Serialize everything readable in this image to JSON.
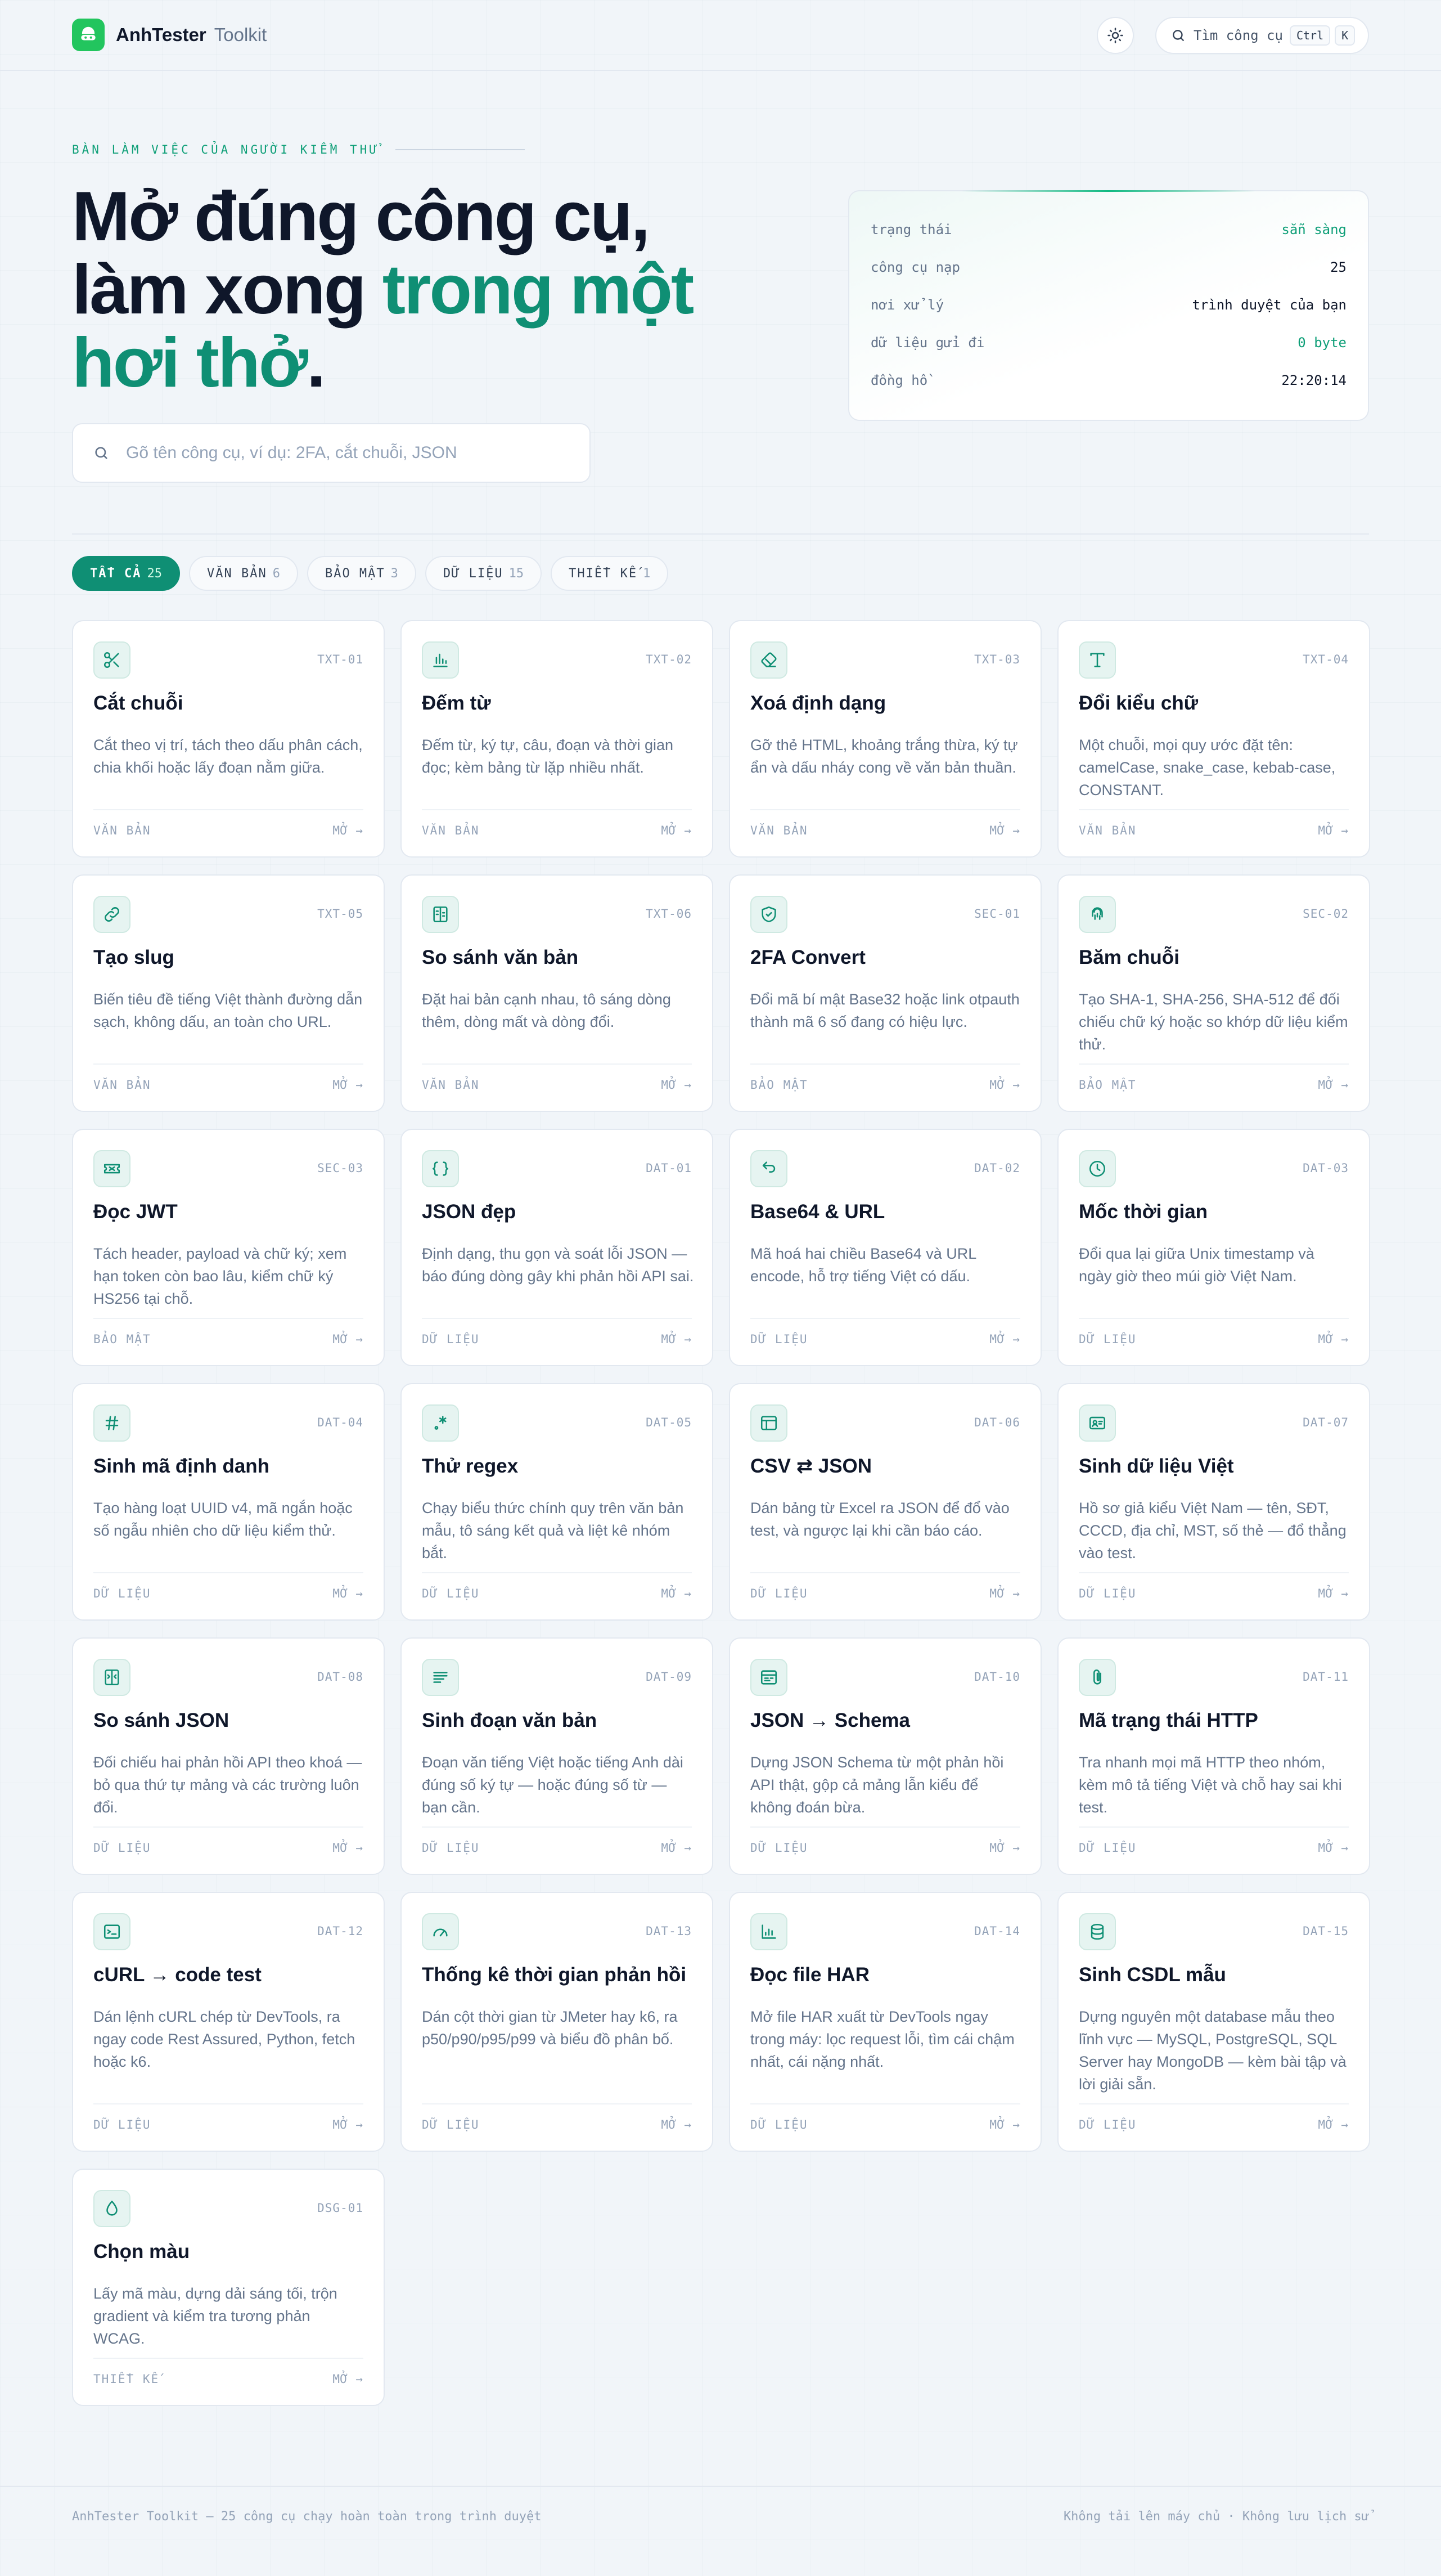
{
  "header": {
    "brand": "AnhTester",
    "brand_sub": "Toolkit",
    "search_label": "Tìm công cụ",
    "shortcut_ctrl": "Ctrl",
    "shortcut_key": "K"
  },
  "hero": {
    "eyebrow": "BÀN LÀM VIỆC CỦA NGƯỜI KIỂM THỬ",
    "title_line1": "Mở đúng công cụ,",
    "title_line2_plain": "làm xong ",
    "title_line2_accent": "trong một",
    "title_line3_accent": "hơi thở",
    "title_line3_end": ".",
    "search_placeholder": "Gõ tên công cụ, ví dụ: 2FA, cắt chuỗi, JSON"
  },
  "status": [
    {
      "key": "trạng thái",
      "value": "sẵn sàng",
      "accent": true
    },
    {
      "key": "công cụ nạp",
      "value": "25",
      "accent": false
    },
    {
      "key": "nơi xử lý",
      "value": "trình duyệt của bạn",
      "accent": false
    },
    {
      "key": "dữ liệu gửi đi",
      "value": "0 byte",
      "accent": true
    },
    {
      "key": "đồng hồ",
      "value": "22:20:14",
      "accent": false
    }
  ],
  "filters": [
    {
      "label": "TẤT CẢ",
      "count": "25",
      "active": true
    },
    {
      "label": "VĂN BẢN",
      "count": "6",
      "active": false
    },
    {
      "label": "BẢO MẬT",
      "count": "3",
      "active": false
    },
    {
      "label": "DỮ LIỆU",
      "count": "15",
      "active": false
    },
    {
      "label": "THIẾT KẾ",
      "count": "1",
      "active": false
    }
  ],
  "open_label": "MỞ →",
  "tools": [
    {
      "code": "TXT-01",
      "icon": "scissors-icon",
      "title": "Cắt chuỗi",
      "desc": "Cắt theo vị trí, tách theo dấu phân cách, chia khối hoặc lấy đoạn nằm giữa.",
      "category": "VĂN BẢN"
    },
    {
      "code": "TXT-02",
      "icon": "bar-count-icon",
      "title": "Đếm từ",
      "desc": "Đếm từ, ký tự, câu, đoạn và thời gian đọc; kèm bảng từ lặp nhiều nhất.",
      "category": "VĂN BẢN"
    },
    {
      "code": "TXT-03",
      "icon": "eraser-icon",
      "title": "Xoá định dạng",
      "desc": "Gỡ thẻ HTML, khoảng trắng thừa, ký tự ẩn và dấu nháy cong về văn bản thuần.",
      "category": "VĂN BẢN"
    },
    {
      "code": "TXT-04",
      "icon": "type-icon",
      "title": "Đổi kiểu chữ",
      "desc": "Một chuỗi, mọi quy ước đặt tên: camelCase, snake_case, kebab-case, CONSTANT.",
      "category": "VĂN BẢN"
    },
    {
      "code": "TXT-05",
      "icon": "link-icon",
      "title": "Tạo slug",
      "desc": "Biến tiêu đề tiếng Việt thành đường dẫn sạch, không dấu, an toàn cho URL.",
      "category": "VĂN BẢN"
    },
    {
      "code": "TXT-06",
      "icon": "diff-icon",
      "title": "So sánh văn bản",
      "desc": "Đặt hai bản cạnh nhau, tô sáng dòng thêm, dòng mất và dòng đổi.",
      "category": "VĂN BẢN"
    },
    {
      "code": "SEC-01",
      "icon": "shield-check-icon",
      "title": "2FA Convert",
      "desc": "Đổi mã bí mật Base32 hoặc link otpauth thành mã 6 số đang có hiệu lực.",
      "category": "BẢO MẬT"
    },
    {
      "code": "SEC-02",
      "icon": "fingerprint-icon",
      "title": "Băm chuỗi",
      "desc": "Tạo SHA-1, SHA-256, SHA-512 để đối chiếu chữ ký hoặc so khớp dữ liệu kiểm thử.",
      "category": "BẢO MẬT"
    },
    {
      "code": "SEC-03",
      "icon": "ticket-icon",
      "title": "Đọc JWT",
      "desc": "Tách header, payload và chữ ký; xem hạn token còn bao lâu, kiểm chữ ký HS256 tại chỗ.",
      "category": "BẢO MẬT"
    },
    {
      "code": "DAT-01",
      "icon": "braces-icon",
      "title": "JSON đẹp",
      "desc": "Định dạng, thu gọn và soát lỗi JSON — báo đúng dòng gây khi phản hồi API sai.",
      "category": "DỮ LIỆU"
    },
    {
      "code": "DAT-02",
      "icon": "arrows-swap-icon",
      "title": "Base64 & URL",
      "desc": "Mã hoá hai chiều Base64 và URL encode, hỗ trợ tiếng Việt có dấu.",
      "category": "DỮ LIỆU"
    },
    {
      "code": "DAT-03",
      "icon": "clock-icon",
      "title": "Mốc thời gian",
      "desc": "Đổi qua lại giữa Unix timestamp và ngày giờ theo múi giờ Việt Nam.",
      "category": "DỮ LIỆU"
    },
    {
      "code": "DAT-04",
      "icon": "hash-icon",
      "title": "Sinh mã định danh",
      "desc": "Tạo hàng loạt UUID v4, mã ngắn hoặc số ngẫu nhiên cho dữ liệu kiểm thử.",
      "category": "DỮ LIỆU"
    },
    {
      "code": "DAT-05",
      "icon": "regex-icon",
      "title": "Thử regex",
      "desc": "Chạy biểu thức chính quy trên văn bản mẫu, tô sáng kết quả và liệt kê nhóm bắt.",
      "category": "DỮ LIỆU"
    },
    {
      "code": "DAT-06",
      "icon": "table-icon",
      "title": "CSV ⇄ JSON",
      "desc": "Dán bảng từ Excel ra JSON để đổ vào test, và ngược lại khi cần báo cáo.",
      "category": "DỮ LIỆU"
    },
    {
      "code": "DAT-07",
      "icon": "id-card-icon",
      "title": "Sinh dữ liệu Việt",
      "desc": "Hồ sơ giả kiểu Việt Nam — tên, SĐT, CCCD, địa chỉ, MST, số thẻ — đổ thẳng vào test.",
      "category": "DỮ LIỆU"
    },
    {
      "code": "DAT-08",
      "icon": "compare-icon",
      "title": "So sánh JSON",
      "desc": "Đối chiếu hai phản hồi API theo khoá — bỏ qua thứ tự mảng và các trường luôn đổi.",
      "category": "DỮ LIỆU"
    },
    {
      "code": "DAT-09",
      "icon": "text-lines-icon",
      "title": "Sinh đoạn văn bản",
      "desc": "Đoạn văn tiếng Việt hoặc tiếng Anh dài đúng số ký tự — hoặc đúng số từ — bạn cần.",
      "category": "DỮ LIỆU"
    },
    {
      "code": "DAT-10",
      "icon": "schema-icon",
      "title": "JSON → Schema",
      "desc": "Dựng JSON Schema từ một phản hồi API thật, gộp cả mảng lẫn kiểu để không đoán bừa.",
      "category": "DỮ LIỆU"
    },
    {
      "code": "DAT-11",
      "icon": "paperclip-icon",
      "title": "Mã trạng thái HTTP",
      "desc": "Tra nhanh mọi mã HTTP theo nhóm, kèm mô tả tiếng Việt và chỗ hay sai khi test.",
      "category": "DỮ LIỆU"
    },
    {
      "code": "DAT-12",
      "icon": "terminal-icon",
      "title": "cURL → code test",
      "desc": "Dán lệnh cURL chép từ DevTools, ra ngay code Rest Assured, Python, fetch hoặc k6.",
      "category": "DỮ LIỆU"
    },
    {
      "code": "DAT-13",
      "icon": "gauge-icon",
      "title": "Thống kê thời gian phản hồi",
      "desc": "Dán cột thời gian từ JMeter hay k6, ra p50/p90/p95/p99 và biểu đồ phân bố.",
      "category": "DỮ LIỆU"
    },
    {
      "code": "DAT-14",
      "icon": "chart-icon",
      "title": "Đọc file HAR",
      "desc": "Mở file HAR xuất từ DevTools ngay trong máy: lọc request lỗi, tìm cái chậm nhất, cái nặng nhất.",
      "category": "DỮ LIỆU"
    },
    {
      "code": "DAT-15",
      "icon": "database-icon",
      "title": "Sinh CSDL mẫu",
      "desc": "Dựng nguyên một database mẫu theo lĩnh vực — MySQL, PostgreSQL, SQL Server hay MongoDB — kèm bài tập và lời giải sẵn.",
      "category": "DỮ LIỆU"
    },
    {
      "code": "DSG-01",
      "icon": "droplet-icon",
      "title": "Chọn màu",
      "desc": "Lấy mã màu, dựng dải sáng tối, trộn gradient và kiểm tra tương phản WCAG.",
      "category": "THIẾT KẾ"
    }
  ],
  "footer": {
    "left": "AnhTester Toolkit — 25 công cụ chạy hoàn toàn trong trình duyệt",
    "right": "Không tải lên máy chủ · Không lưu lịch sử"
  },
  "colors": {
    "accent": "#0f8f74",
    "logo": "#22c55e",
    "background": "#f1f5f9"
  }
}
